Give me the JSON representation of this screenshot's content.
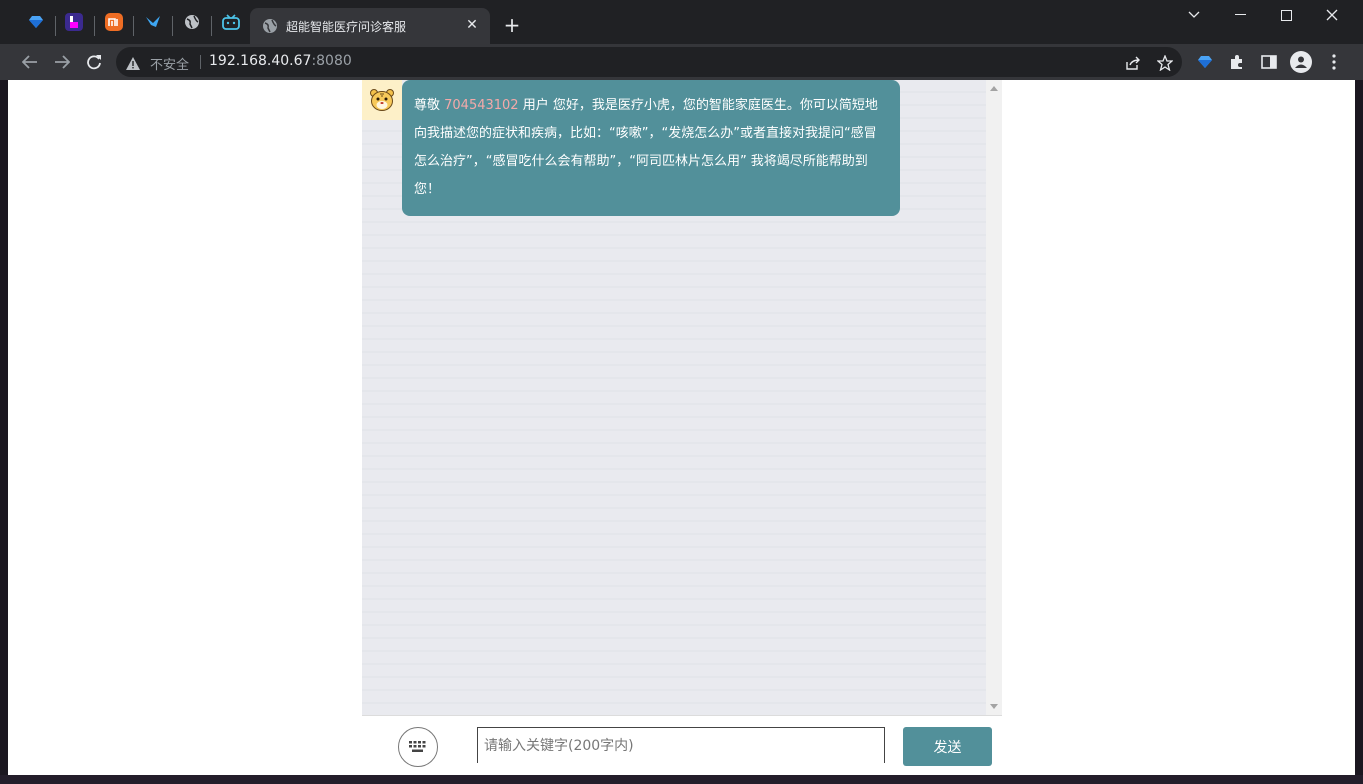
{
  "browser": {
    "active_tab_title": "超能智能医疗问诊客服",
    "close_tab_glyph": "✕",
    "new_tab_glyph": "+",
    "url_insecure_label": "不安全",
    "url_host": "192.168.40.67",
    "url_port": ":8080",
    "pinned_tabs": [
      "gem-icon",
      "bookmark-app-icon",
      "mi-icon",
      "bird-icon",
      "globe-icon",
      "bilibili-icon"
    ]
  },
  "chat": {
    "welcome": {
      "prefix": "尊敬 ",
      "user_id": "704543102",
      "body": " 用户 您好，我是医疗小虎，您的智能家庭医生。你可以简短地向我描述您的症状和疾病，比如：“咳嗽”，“发烧怎么办”或者直接对我提问“感冒怎么治疗”，“感冒吃什么会有帮助”，“阿司匹林片怎么用” 我将竭尽所能帮助到您！"
    }
  },
  "input": {
    "placeholder": "请输入关键字(200字内)",
    "value": ""
  },
  "send_button": {
    "label": "发送"
  },
  "colors": {
    "accent": "#52909a",
    "user_id": "#f3a9a9",
    "chat_bg": "#e9eaef"
  }
}
